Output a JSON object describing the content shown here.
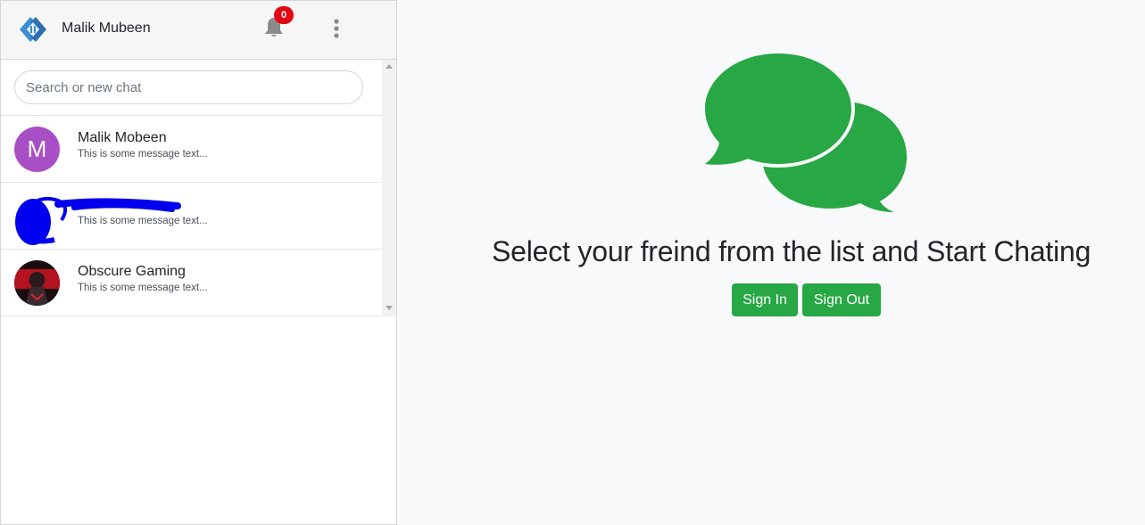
{
  "header": {
    "user_name": "Malik Mubeen",
    "notification_count": "0",
    "logo_icon": "app-logo-icon",
    "bell_icon": "bell-icon",
    "menu_icon": "more-vertical-icon"
  },
  "search": {
    "placeholder": "Search or new chat"
  },
  "chats": [
    {
      "name": "Malik Mobeen",
      "message": "This is some message text...",
      "avatar": "M",
      "avatar_color": "#a94fc6"
    },
    {
      "name": "",
      "message": "This is some message text...",
      "avatar": "",
      "redacted": true
    },
    {
      "name": "Obscure Gaming",
      "message": "This is some message text...",
      "avatar": "gaming-avatar-image"
    }
  ],
  "main": {
    "title": "Select your freind from the list and Start Chating",
    "sign_in_label": "Sign In",
    "sign_out_label": "Sign Out",
    "illustration_icon": "chat-bubbles-icon",
    "accent_color": "#28a745"
  }
}
